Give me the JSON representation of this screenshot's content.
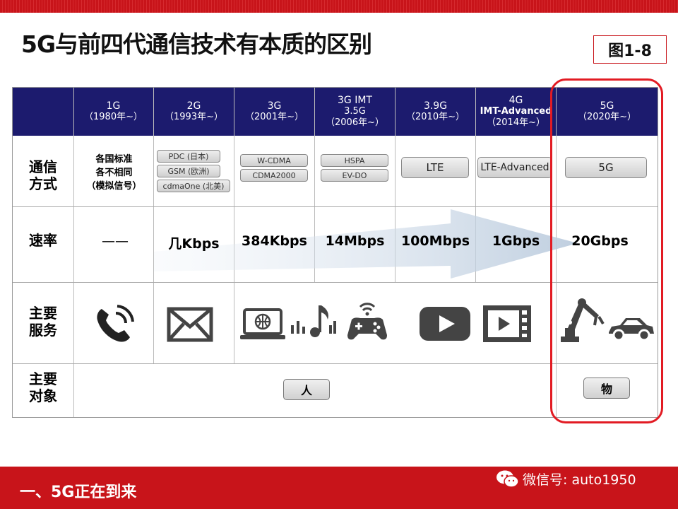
{
  "title": "5G与前四代通信技术有本质的区别",
  "figure_label": "图1-8",
  "columns": [
    {
      "name": "1G",
      "year": "（1980年~）"
    },
    {
      "name": "2G",
      "year": "（1993年~）"
    },
    {
      "name": "3G",
      "year": "（2001年~）"
    },
    {
      "name": "3G  IMT",
      "name2": "3.5G",
      "year": "（2006年~）"
    },
    {
      "name": "3.9G",
      "year": "（2010年~）"
    },
    {
      "name": "4G",
      "name2": "IMT-Advanced",
      "year": "（2014年~）"
    },
    {
      "name": "5G",
      "year": "（2020年~）"
    }
  ],
  "row_labels": {
    "comm": "通信\n方式",
    "speed": "速率",
    "service": "主要\n服务",
    "object": "主要\n对象"
  },
  "comm": {
    "g1": "各国标准\n各不相同\n（模拟信号）",
    "g2": [
      "PDC (日本)",
      "GSM (欧洲)",
      "cdmaOne (北美)"
    ],
    "g3": [
      "W-CDMA",
      "CDMA2000"
    ],
    "g35": [
      "HSPA",
      "EV-DO"
    ],
    "g39": "LTE",
    "g4": "LTE-Advanced",
    "g5": "5G"
  },
  "speeds": [
    "——",
    "几Kbps",
    "384Kbps",
    "14Mbps",
    "100Mbps",
    "1Gbps",
    "20Gbps"
  ],
  "services": [
    "phone-icon",
    "mail-icon",
    "computer-icon",
    "music-icon",
    "gamepad-icon",
    "video-play-icon",
    "video-screen-icon",
    "robot-arm-icon",
    "car-icon"
  ],
  "objects": {
    "people": "人",
    "things": "物"
  },
  "footer": {
    "section_title": "一、5G正在到来",
    "wechat": "微信号: auto1950"
  },
  "colors": {
    "header_bg": "#1c1b6e",
    "accent_red": "#c8141a",
    "highlight_border": "#e21b23"
  }
}
